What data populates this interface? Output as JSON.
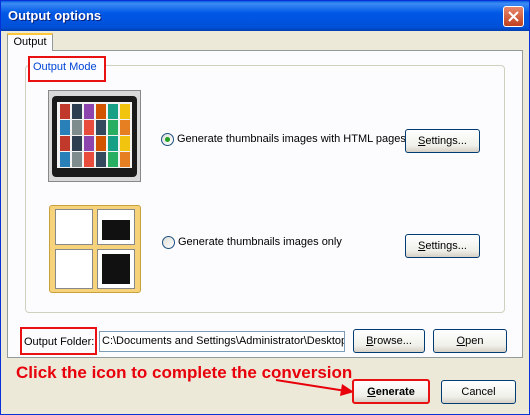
{
  "window": {
    "title": "Output options"
  },
  "tabs": [
    {
      "label": "Output"
    }
  ],
  "output_mode": {
    "label": "Output Mode",
    "options": [
      {
        "label": "Generate thumbnails images with HTML pages",
        "settings_label": "Settings...",
        "selected": true
      },
      {
        "label": "Generate thumbnails images only",
        "settings_label": "Settings...",
        "selected": false
      }
    ]
  },
  "output_folder": {
    "label": "Output Folder:",
    "value": "C:\\Documents and Settings\\Administrator\\Desktop",
    "browse_label": "Browse...",
    "open_label": "Open"
  },
  "annotation": {
    "text": "Click the icon to complete the conversion",
    "color": "#e8000b"
  },
  "footer": {
    "generate_label": "Generate",
    "cancel_label": "Cancel"
  },
  "colors": {
    "title_bar": "#0058e6",
    "highlight_box": "#e81010",
    "group_label": "#0046d5"
  }
}
